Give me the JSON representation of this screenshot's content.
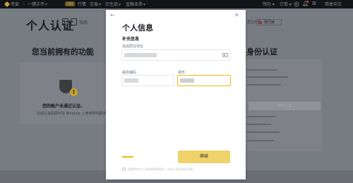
{
  "topbar": {
    "brand": "币安",
    "nav": [
      {
        "label": "一键买币",
        "badge": "USD"
      },
      {
        "label": "行情"
      },
      {
        "label": "交易"
      },
      {
        "label": "衍生品"
      },
      {
        "label": "金融业务"
      }
    ],
    "right": {
      "language": "钱包",
      "orders": "订单",
      "download": "简体中文"
    }
  },
  "background": {
    "page_title": "个人认证",
    "help_label": "指南",
    "left_heading": "您当前拥有的功能",
    "account_status": "您的账户未通过认证。",
    "account_desc": "完成认证后即可在 Binance 上使用所有服务。",
    "region_label": "居住地区",
    "region_value": "黎巴嫩",
    "right_heading": "身份认证",
    "right_button": "开始认证"
  },
  "modal": {
    "title": "个人信息",
    "section": "补充信息",
    "address_label": "完成居住地址",
    "postal_label": "邮政编码",
    "city_label": "城市",
    "continue_label": "继续",
    "note": "您提供的个人信息将受到保护，仅用于身份验证目的。",
    "colors": {
      "accent": "#f0b90b",
      "button": "#f0d26a"
    },
    "icons": [
      "back-arrow-icon",
      "close-icon",
      "id-card-icon",
      "info-icon"
    ]
  }
}
